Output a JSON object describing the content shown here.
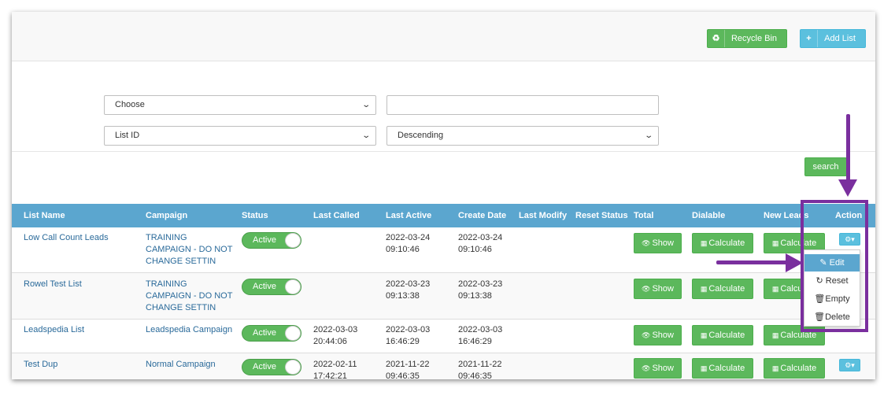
{
  "toolbar": {
    "recycle_label": "Recycle Bin",
    "add_label": "Add List"
  },
  "filters": {
    "field_select": "Choose",
    "search_value": "",
    "sort_by": "List ID",
    "sort_order": "Descending",
    "search_label": "search"
  },
  "table": {
    "headers": [
      "List Name",
      "Campaign",
      "Status",
      "Last Called",
      "Last Active",
      "Create Date",
      "Last Modify",
      "Reset Status",
      "Total",
      "Dialable",
      "New Leads",
      "Action"
    ],
    "rows": [
      {
        "list_name": "Low Call Count Leads",
        "campaign": "TRAINING CAMPAIGN - DO NOT CHANGE SETTIN",
        "status": "Active",
        "last_called": "",
        "last_active": "2022-03-24 09:10:46",
        "create_date": "2022-03-24 09:10:46",
        "last_modify": "",
        "reset_status": ""
      },
      {
        "list_name": "Rowel Test List",
        "campaign": "TRAINING CAMPAIGN - DO NOT CHANGE SETTIN",
        "status": "Active",
        "last_called": "",
        "last_active": "2022-03-23 09:13:38",
        "create_date": "2022-03-23 09:13:38",
        "last_modify": "",
        "reset_status": ""
      },
      {
        "list_name": "Leadspedia List",
        "campaign": "Leadspedia Campaign",
        "status": "Active",
        "last_called": "2022-03-03 20:44:06",
        "last_active": "2022-03-03 16:46:29",
        "create_date": "2022-03-03 16:46:29",
        "last_modify": "",
        "reset_status": ""
      },
      {
        "list_name": "Test Dup",
        "campaign": "Normal Campaign",
        "status": "Active",
        "last_called": "2022-02-11 17:42:21",
        "last_active": "2021-11-22 09:46:35",
        "create_date": "2021-11-22 09:46:35",
        "last_modify": "",
        "reset_status": ""
      }
    ],
    "show_label": "Show",
    "calculate_label": "Calculate"
  },
  "action_menu": {
    "items": [
      "Edit",
      "Reset",
      "Empty",
      "Delete"
    ],
    "active_item": "Edit"
  },
  "annotation": {
    "color": "#7a2f9e"
  }
}
